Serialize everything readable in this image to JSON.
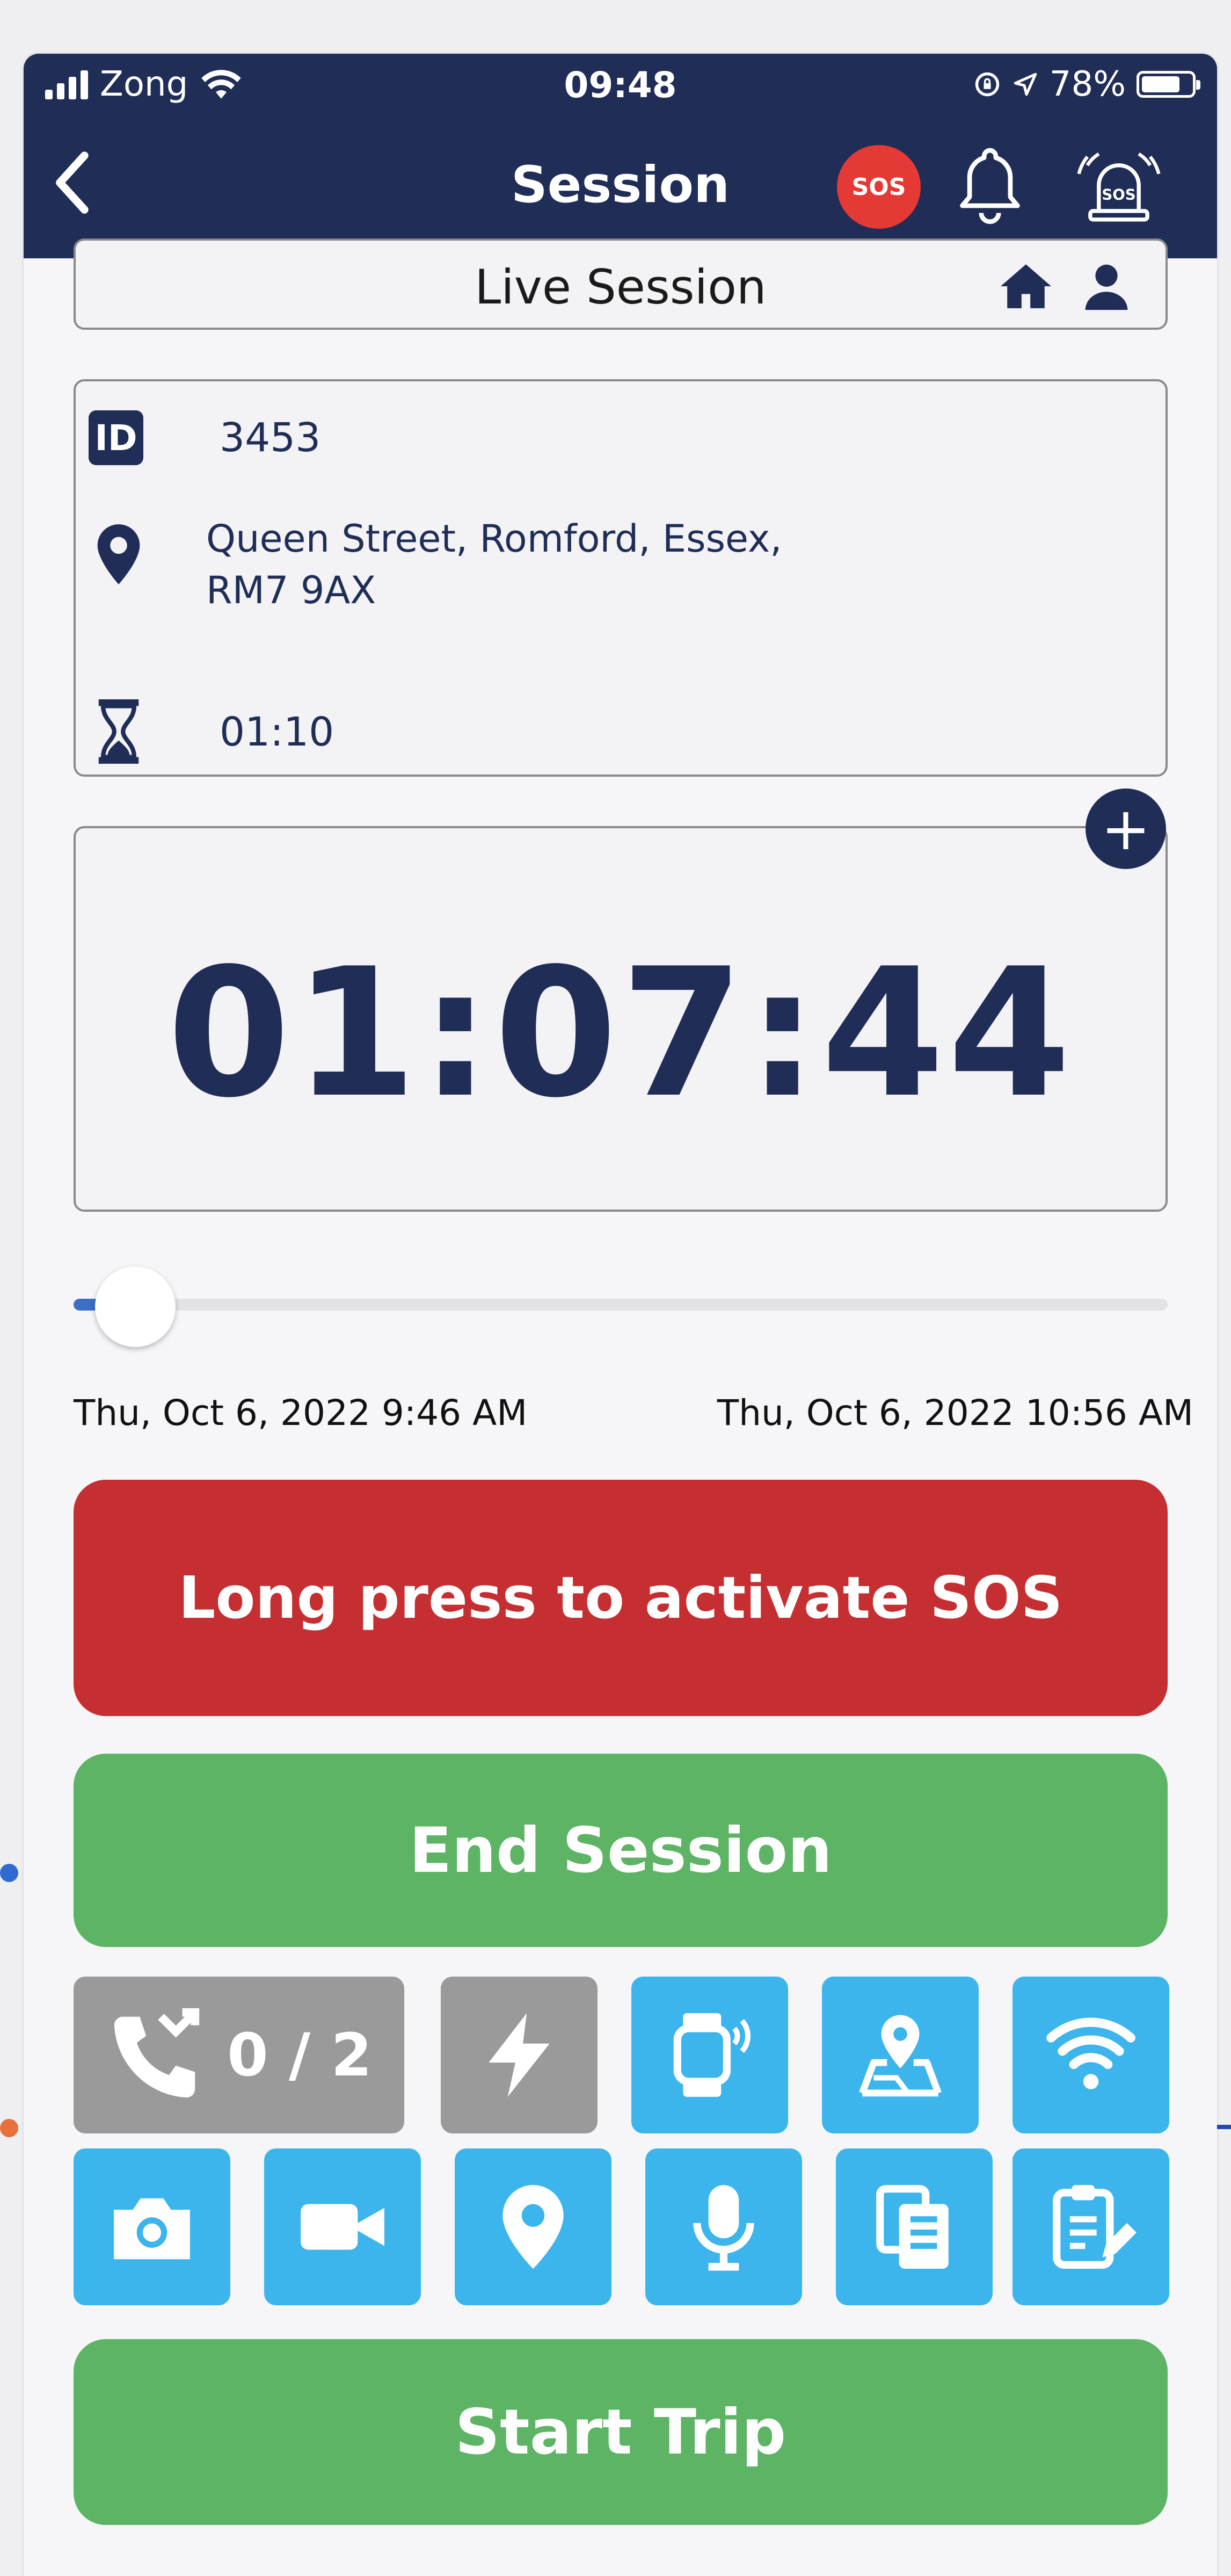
{
  "status_bar": {
    "carrier": "Zong",
    "time": "09:48",
    "battery": "78%"
  },
  "nav": {
    "title": "Session",
    "sos_badge": "SOS",
    "sos_alarm_label": "SOS"
  },
  "live_session": {
    "title": "Live Session"
  },
  "info": {
    "id_badge": "ID",
    "id_value": "3453",
    "address_line1": "Queen Street, Romford, Essex,",
    "address_line2": "RM7 9AX",
    "duration": "01:10"
  },
  "timer": {
    "value": "01:07:44",
    "add_label": "+"
  },
  "slider": {
    "start_label": "Thu, Oct 6, 2022 9:46 AM",
    "end_label": "Thu, Oct 6, 2022 10:56 AM",
    "progress": 0.03
  },
  "buttons": {
    "sos": "Long press to activate SOS",
    "end_session": "End Session",
    "start_trip": "Start Trip"
  },
  "tiles": {
    "calls_count": "0 / 2",
    "row1_icons": [
      "missed-call-icon",
      "flash-icon",
      "smartwatch-icon",
      "map-location-icon",
      "wifi-icon"
    ],
    "row2_icons": [
      "camera-icon",
      "video-camera-icon",
      "location-pin-icon",
      "microphone-icon",
      "documents-icon",
      "clipboard-edit-icon"
    ]
  },
  "colors": {
    "header": "#1f2d57",
    "sos_red": "#c62f32",
    "green": "#5cb464",
    "tile_blue": "#3cb5ec",
    "tile_gray": "#9a9a9a"
  }
}
